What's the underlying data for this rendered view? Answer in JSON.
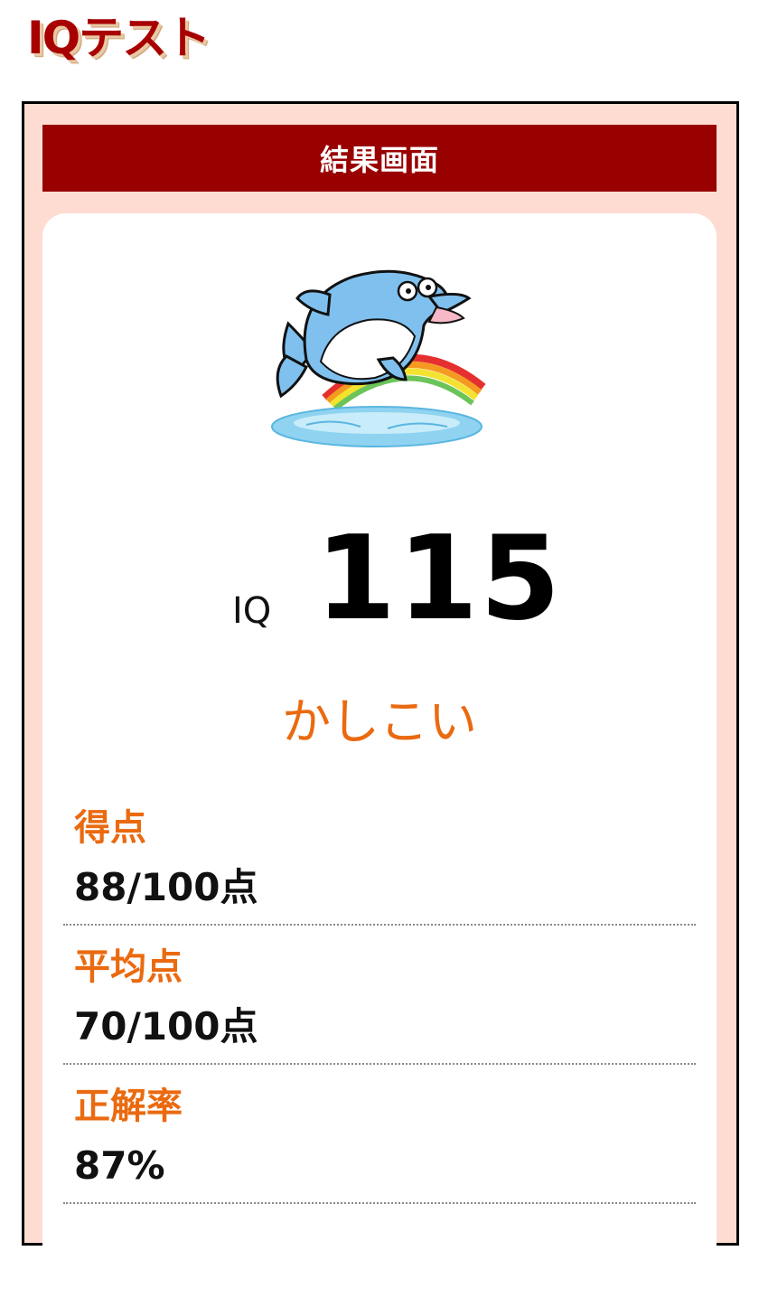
{
  "header": {
    "logo_text": "IQテスト"
  },
  "result_panel": {
    "title": "結果画面"
  },
  "mascot": {
    "icon": "dolphin-with-glasses-icon"
  },
  "iq": {
    "label": "IQ",
    "value": "115"
  },
  "rank": {
    "text": "かしこい"
  },
  "stats": [
    {
      "label": "得点",
      "value": "88/100点"
    },
    {
      "label": "平均点",
      "value": "70/100点"
    },
    {
      "label": "正解率",
      "value": "87%"
    }
  ],
  "colors": {
    "brand_red": "#990000",
    "accent_orange": "#ea6a10",
    "panel_pink": "#ffdcd2"
  }
}
